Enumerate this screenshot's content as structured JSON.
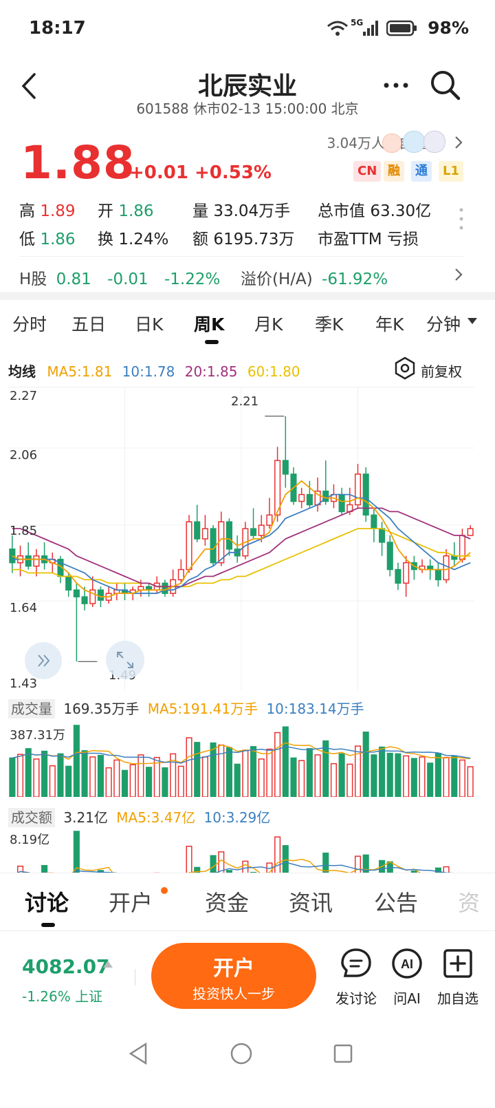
{
  "status_bar": {
    "time": "18:17",
    "network": "5G",
    "battery": "98%"
  },
  "header": {
    "title": "北辰实业",
    "subtitle": "601588 休市02-13 15:00:00 北京"
  },
  "quote": {
    "price": "1.88",
    "change": "+0.01",
    "change_pct": "+0.53%",
    "followers": "3.04万人加自选",
    "badges": [
      "CN",
      "融",
      "通",
      "L1"
    ],
    "high_label": "高",
    "high": "1.89",
    "open_label": "开",
    "open": "1.86",
    "volume_label": "量",
    "volume": "33.04万手",
    "mktcap_label": "总市值",
    "mktcap": "63.30亿",
    "low_label": "低",
    "low": "1.86",
    "turnover_label": "换",
    "turnover": "1.24%",
    "amount_label": "额",
    "amount": "6195.73万",
    "pe_label": "市盈TTM",
    "pe": "亏损",
    "h_label": "H股",
    "h_price": "0.81",
    "h_change": "-0.01",
    "h_change_pct": "-1.22%",
    "premium_label": "溢价(H/A)",
    "premium": "-61.92%"
  },
  "chart_tabs": [
    "分时",
    "五日",
    "日K",
    "周K",
    "月K",
    "季K",
    "年K",
    "分钟"
  ],
  "ma": {
    "label": "均线",
    "ma5": "MA5:1.81",
    "ma10": "10:1.78",
    "ma20": "20:1.85",
    "ma60": "60:1.80",
    "adjust": "前复权"
  },
  "colors": {
    "up": "#e93030",
    "down": "#1e9e6a",
    "ma5": "#f0a000",
    "ma10": "#3a7fc0",
    "ma20": "#a0307a",
    "ma60": "#e8c000",
    "accent": "#ff6a12"
  },
  "chart_data": {
    "type": "candlestick",
    "y_ticks": [
      "2.27",
      "2.06",
      "1.85",
      "1.64",
      "1.43"
    ],
    "ylim": [
      1.43,
      2.27
    ],
    "max_label": "2.21",
    "min_label": "1.49",
    "candles": [
      [
        1.82,
        1.78,
        1.86,
        1.75
      ],
      [
        1.78,
        1.8,
        1.83,
        1.74
      ],
      [
        1.8,
        1.77,
        1.84,
        1.76
      ],
      [
        1.77,
        1.8,
        1.82,
        1.74
      ],
      [
        1.8,
        1.78,
        1.84,
        1.76
      ],
      [
        1.78,
        1.79,
        1.81,
        1.75
      ],
      [
        1.79,
        1.74,
        1.8,
        1.72
      ],
      [
        1.74,
        1.7,
        1.75,
        1.68
      ],
      [
        1.7,
        1.68,
        1.72,
        1.49
      ],
      [
        1.68,
        1.66,
        1.71,
        1.64
      ],
      [
        1.66,
        1.7,
        1.74,
        1.65
      ],
      [
        1.7,
        1.67,
        1.71,
        1.65
      ],
      [
        1.67,
        1.69,
        1.71,
        1.66
      ],
      [
        1.69,
        1.7,
        1.72,
        1.67
      ],
      [
        1.7,
        1.69,
        1.72,
        1.67
      ],
      [
        1.69,
        1.7,
        1.71,
        1.67
      ],
      [
        1.7,
        1.71,
        1.73,
        1.68
      ],
      [
        1.71,
        1.7,
        1.72,
        1.68
      ],
      [
        1.7,
        1.72,
        1.74,
        1.69
      ],
      [
        1.72,
        1.69,
        1.73,
        1.68
      ],
      [
        1.69,
        1.73,
        1.76,
        1.68
      ],
      [
        1.73,
        1.76,
        1.79,
        1.72
      ],
      [
        1.76,
        1.9,
        1.92,
        1.75
      ],
      [
        1.9,
        1.85,
        1.95,
        1.84
      ],
      [
        1.85,
        1.88,
        1.92,
        1.83
      ],
      [
        1.88,
        1.78,
        1.89,
        1.77
      ],
      [
        1.78,
        1.9,
        1.93,
        1.77
      ],
      [
        1.9,
        1.82,
        1.91,
        1.8
      ],
      [
        1.82,
        1.8,
        1.86,
        1.78
      ],
      [
        1.8,
        1.88,
        1.9,
        1.79
      ],
      [
        1.88,
        1.86,
        1.94,
        1.85
      ],
      [
        1.86,
        1.89,
        1.92,
        1.84
      ],
      [
        1.89,
        1.92,
        1.97,
        1.88
      ],
      [
        1.92,
        2.08,
        2.12,
        1.9
      ],
      [
        2.08,
        2.04,
        2.21,
        2.0
      ],
      [
        2.04,
        1.96,
        2.06,
        1.95
      ],
      [
        1.96,
        1.98,
        2.0,
        1.94
      ],
      [
        1.98,
        1.95,
        2.02,
        1.94
      ],
      [
        1.95,
        1.99,
        2.03,
        1.93
      ],
      [
        1.99,
        1.96,
        2.08,
        1.95
      ],
      [
        1.96,
        1.98,
        2.01,
        1.94
      ],
      [
        1.98,
        1.93,
        2.0,
        1.92
      ],
      [
        1.93,
        1.95,
        2.0,
        1.92
      ],
      [
        1.95,
        2.04,
        2.07,
        1.94
      ],
      [
        2.04,
        1.92,
        2.06,
        1.9
      ],
      [
        1.92,
        1.88,
        1.94,
        1.84
      ],
      [
        1.88,
        1.84,
        1.9,
        1.8
      ],
      [
        1.84,
        1.76,
        1.86,
        1.74
      ],
      [
        1.76,
        1.72,
        1.78,
        1.7
      ],
      [
        1.72,
        1.78,
        1.8,
        1.68
      ],
      [
        1.78,
        1.76,
        1.8,
        1.73
      ],
      [
        1.76,
        1.77,
        1.79,
        1.75
      ],
      [
        1.77,
        1.76,
        1.79,
        1.73
      ],
      [
        1.76,
        1.73,
        1.78,
        1.71
      ],
      [
        1.73,
        1.8,
        1.82,
        1.72
      ],
      [
        1.8,
        1.79,
        1.84,
        1.77
      ],
      [
        1.79,
        1.86,
        1.88,
        1.78
      ],
      [
        1.86,
        1.88,
        1.89,
        1.86
      ]
    ],
    "ma5": [
      1.8,
      1.79,
      1.79,
      1.79,
      1.79,
      1.78,
      1.77,
      1.75,
      1.72,
      1.7,
      1.69,
      1.68,
      1.68,
      1.69,
      1.69,
      1.69,
      1.7,
      1.7,
      1.7,
      1.7,
      1.71,
      1.72,
      1.76,
      1.79,
      1.82,
      1.82,
      1.85,
      1.85,
      1.83,
      1.84,
      1.85,
      1.85,
      1.87,
      1.93,
      1.98,
      2.0,
      2.02,
      2.0,
      1.98,
      1.97,
      1.97,
      1.96,
      1.96,
      1.97,
      1.96,
      1.94,
      1.91,
      1.87,
      1.82,
      1.79,
      1.77,
      1.76,
      1.76,
      1.76,
      1.76,
      1.77,
      1.79,
      1.81
    ],
    "ma10": [
      1.79,
      1.79,
      1.79,
      1.79,
      1.79,
      1.79,
      1.78,
      1.77,
      1.76,
      1.75,
      1.73,
      1.72,
      1.71,
      1.7,
      1.7,
      1.69,
      1.69,
      1.69,
      1.69,
      1.7,
      1.7,
      1.71,
      1.73,
      1.74,
      1.76,
      1.77,
      1.79,
      1.81,
      1.81,
      1.83,
      1.84,
      1.85,
      1.86,
      1.88,
      1.91,
      1.92,
      1.93,
      1.94,
      1.95,
      1.97,
      1.98,
      1.98,
      1.98,
      1.97,
      1.97,
      1.95,
      1.93,
      1.91,
      1.88,
      1.86,
      1.84,
      1.82,
      1.8,
      1.78,
      1.77,
      1.76,
      1.77,
      1.78
    ],
    "ma20": [
      1.88,
      1.88,
      1.87,
      1.86,
      1.85,
      1.84,
      1.83,
      1.82,
      1.8,
      1.79,
      1.78,
      1.77,
      1.76,
      1.75,
      1.74,
      1.73,
      1.72,
      1.72,
      1.71,
      1.71,
      1.71,
      1.71,
      1.72,
      1.73,
      1.74,
      1.74,
      1.75,
      1.76,
      1.77,
      1.78,
      1.79,
      1.8,
      1.81,
      1.83,
      1.85,
      1.86,
      1.87,
      1.88,
      1.89,
      1.9,
      1.91,
      1.92,
      1.93,
      1.94,
      1.94,
      1.94,
      1.94,
      1.93,
      1.93,
      1.92,
      1.91,
      1.9,
      1.89,
      1.88,
      1.87,
      1.86,
      1.86,
      1.85
    ],
    "ma60": [
      1.76,
      1.76,
      1.75,
      1.75,
      1.75,
      1.75,
      1.74,
      1.74,
      1.74,
      1.73,
      1.73,
      1.73,
      1.72,
      1.72,
      1.72,
      1.72,
      1.72,
      1.72,
      1.71,
      1.71,
      1.71,
      1.71,
      1.71,
      1.72,
      1.72,
      1.72,
      1.73,
      1.73,
      1.74,
      1.74,
      1.75,
      1.76,
      1.77,
      1.78,
      1.79,
      1.8,
      1.81,
      1.82,
      1.83,
      1.84,
      1.85,
      1.86,
      1.87,
      1.88,
      1.88,
      1.88,
      1.88,
      1.87,
      1.86,
      1.85,
      1.84,
      1.83,
      1.82,
      1.81,
      1.81,
      1.8,
      1.8,
      1.8
    ]
  },
  "volume": {
    "label": "成交量",
    "value": "169.35万手",
    "ma5": "MA5:191.41万手",
    "ma10": "10:183.14万手",
    "max_tick": "387.31万"
  },
  "amount_panel": {
    "label": "成交额",
    "value": "3.21亿",
    "ma5": "MA5:3.47亿",
    "ma10": "10:3.29亿",
    "max_tick": "8.19亿"
  },
  "bottom_tabs": [
    "讨论",
    "开户",
    "资金",
    "资讯",
    "公告",
    "资"
  ],
  "index": {
    "value": "4082.07",
    "change": "-1.26%",
    "name": "上证"
  },
  "open_button": {
    "label": "开户",
    "sub": "投资快人一步"
  },
  "actions": [
    "发讨论",
    "问AI",
    "加自选"
  ]
}
